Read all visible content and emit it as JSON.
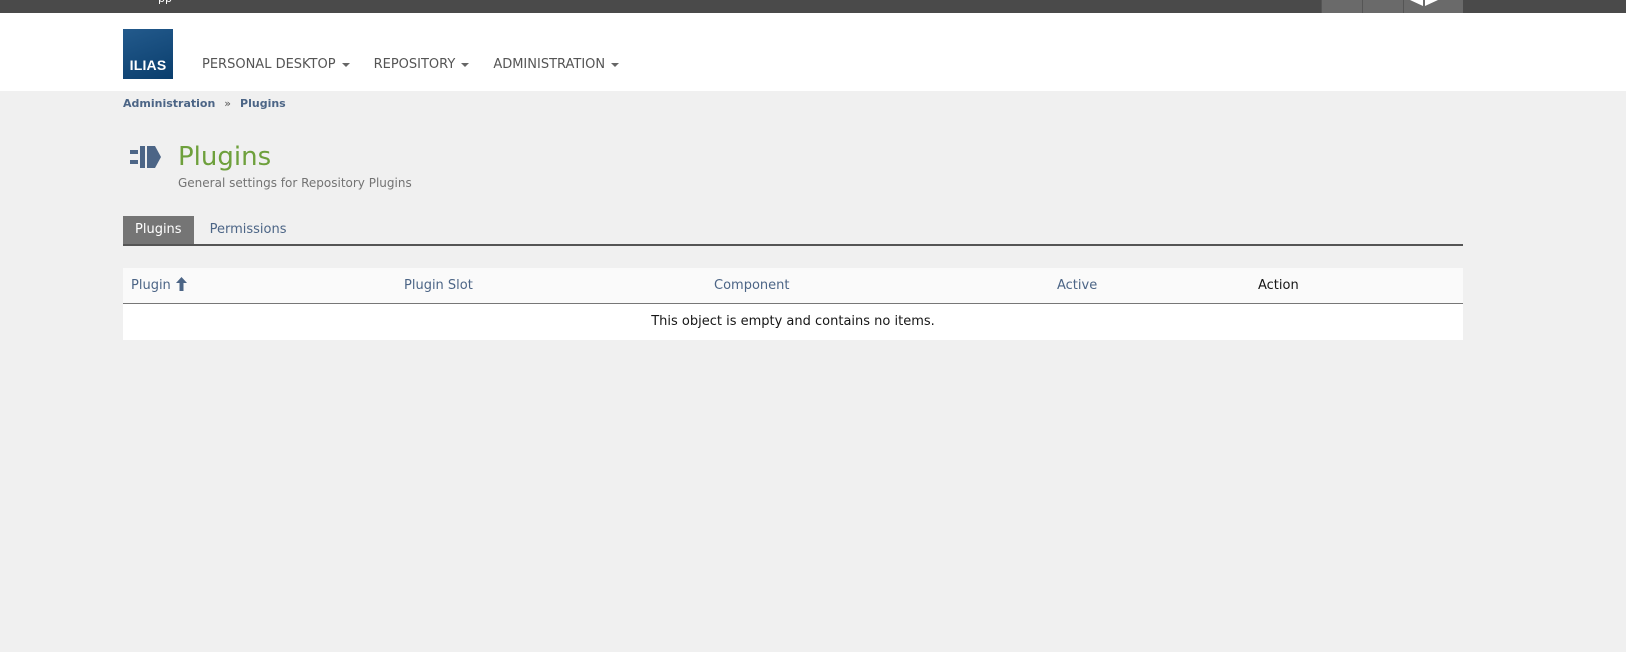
{
  "topbar": {
    "fragment_text": "pp"
  },
  "header": {
    "logo_text": "ILIAS",
    "nav": [
      {
        "label": "PERSONAL DESKTOP"
      },
      {
        "label": "REPOSITORY"
      },
      {
        "label": "ADMINISTRATION"
      }
    ]
  },
  "breadcrumb": {
    "items": [
      "Administration",
      "Plugins"
    ],
    "separator": "»"
  },
  "page": {
    "title": "Plugins",
    "description": "General settings for Repository Plugins",
    "icon": "plug-icon"
  },
  "tabs": [
    {
      "label": "Plugins",
      "active": true
    },
    {
      "label": "Permissions",
      "active": false
    }
  ],
  "table": {
    "columns": [
      {
        "label": "Plugin",
        "sorted": "ascending",
        "sort_icon": "arrow-up-icon"
      },
      {
        "label": "Plugin Slot"
      },
      {
        "label": "Component"
      },
      {
        "label": "Active"
      },
      {
        "label": "Action"
      }
    ],
    "empty_message": "This object is empty and contains no items."
  },
  "colors": {
    "accent_green": "#6ea03c",
    "link_blue": "#4c6586",
    "logo_blue": "#0a3e6d",
    "topbar": "#4a4a4a",
    "tab_active": "#757575"
  }
}
